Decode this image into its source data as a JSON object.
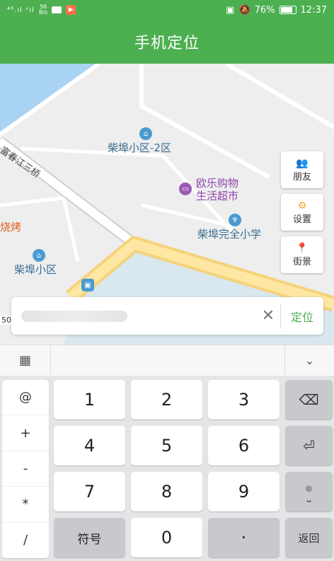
{
  "status_bar": {
    "signal_left": "⁴⁶.ıl ˣıl",
    "net_speed_top": "56",
    "net_speed_bottom": "B/s",
    "battery_percent": "76%",
    "time": "12:37"
  },
  "app_bar": {
    "title": "手机定位"
  },
  "map": {
    "pois": {
      "chaibu_2": "柴埠小区-2区",
      "oule_line1": "欧乐购物",
      "oule_line2": "生活超市",
      "school": "柴埠完全小学",
      "chaibu": "柴埠小区",
      "bbq": "烧烤"
    },
    "road": "富春江三桥",
    "scale": "50"
  },
  "side_buttons": {
    "friends": "朋友",
    "settings": "设置",
    "street": "街景"
  },
  "search": {
    "clear": "✕",
    "locate": "定位"
  },
  "keyboard": {
    "symbols": [
      "@",
      "+",
      "-",
      "*",
      "/"
    ],
    "digits": {
      "k1": "1",
      "k2": "2",
      "k3": "3",
      "k4": "4",
      "k5": "5",
      "k6": "6",
      "k7": "7",
      "k8": "8",
      "k9": "9",
      "k0": "0"
    },
    "symbol_key": "符号",
    "dot": "·",
    "return_key": "返回"
  }
}
